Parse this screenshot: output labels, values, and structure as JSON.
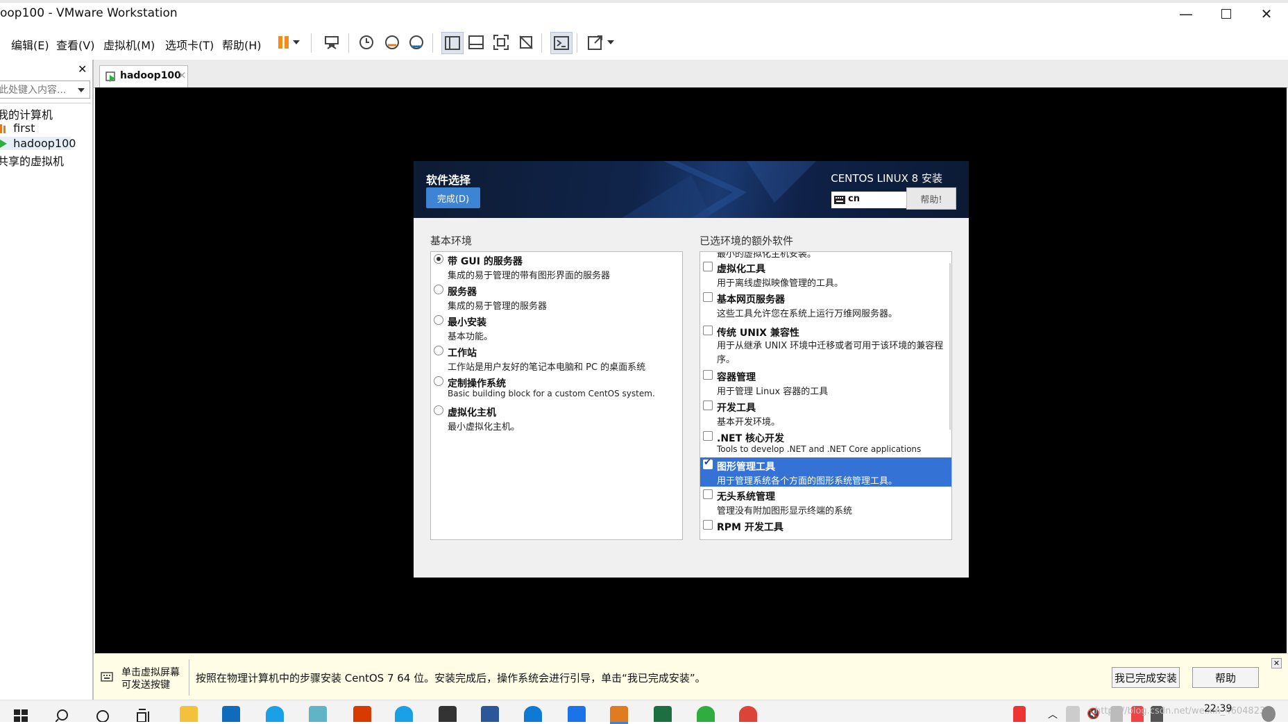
{
  "window": {
    "title": "oop100 - VMware Workstation"
  },
  "menu": {
    "items": [
      "编辑(E)",
      "查看(V)",
      "虚拟机(M)",
      "选项卡(T)",
      "帮助(H)"
    ]
  },
  "toolbar": {
    "icons": [
      "pause-icon",
      "dropdown-arrow-icon",
      "send-ctrl-alt-del-icon",
      "snapshot-icon",
      "revert-snapshot-icon",
      "snapshot-manager-icon",
      "library-view-icon",
      "thumbnail-view-icon",
      "fit-guest-icon",
      "fullscreen-off-icon",
      "console-icon",
      "fullscreen-icon",
      "dropdown-arrow-icon"
    ]
  },
  "sidebar": {
    "close_glyph": "✕",
    "search_placeholder": "此处键入内容...",
    "items": [
      {
        "label": "我的计算机",
        "icon": "computer-icon"
      },
      {
        "label": "first",
        "icon": "vm-icon"
      },
      {
        "label": "hadoop100",
        "icon": "vm-running-icon"
      },
      {
        "label": "共享的虚拟机",
        "icon": "shared-icon"
      }
    ]
  },
  "tab": {
    "label": "hadoop100",
    "close": "×"
  },
  "installer": {
    "section_title": "软件选择",
    "done_button": "完成(D)",
    "product": "CENTOS LINUX 8 安装",
    "keyboard": "cn",
    "help_button": "帮助!",
    "base_env_title": "基本环境",
    "addons_title": "已选环境的额外软件",
    "environments": [
      {
        "title": "带 GUI 的服务器",
        "desc": "集成的易于管理的带有图形界面的服务器",
        "selected": true
      },
      {
        "title": "服务器",
        "desc": "集成的易于管理的服务器",
        "selected": false
      },
      {
        "title": "最小安装",
        "desc": "基本功能。",
        "selected": false
      },
      {
        "title": "工作站",
        "desc": "工作站是用户友好的笔记本电脑和 PC 的桌面系统",
        "selected": false
      },
      {
        "title": "定制操作系统",
        "desc": "Basic building block for a custom CentOS system.",
        "selected": false
      },
      {
        "title": "虚拟化主机",
        "desc": "最小虚拟化主机。",
        "selected": false
      }
    ],
    "addons_partial_top": "最小的虚拟化主机安装。",
    "addons": [
      {
        "title": "虚拟化工具",
        "desc": "用于离线虚拟映像管理的工具。",
        "checked": false
      },
      {
        "title": "基本网页服务器",
        "desc": "这些工具允许您在系统上运行万维网服务器。",
        "checked": false
      },
      {
        "title": "传统 UNIX 兼容性",
        "desc": "用于从继承 UNIX 环境中迁移或者可用于该环境的兼容程序。",
        "checked": false
      },
      {
        "title": "容器管理",
        "desc": "用于管理 Linux 容器的工具",
        "checked": false
      },
      {
        "title": "开发工具",
        "desc": "基本开发环境。",
        "checked": false
      },
      {
        "title": ".NET 核心开发",
        "desc": "Tools to develop .NET and .NET Core applications",
        "checked": false
      },
      {
        "title": "图形管理工具",
        "desc": "用于管理系统各个方面的图形系统管理工具。",
        "checked": true
      },
      {
        "title": "无头系统管理",
        "desc": "管理没有附加图形显示终端的系统",
        "checked": false
      },
      {
        "title": "RPM 开发工具",
        "desc": "",
        "checked": false
      }
    ]
  },
  "notice": {
    "hint_line1": "单击虚拟屏幕",
    "hint_line2": "可发送按键",
    "message": "按照在物理计算机中的步骤安装 CentOS 7 64 位。安装完成后，操作系统会进行引导，单击“我已完成安装”。",
    "done_button": "我已完成安装",
    "help_button": "帮助",
    "close": "✕"
  },
  "taskbar": {
    "clock": "22:39",
    "watermark": "https://blog.csdn.net/weixin_46048230",
    "colors": {
      "excel": "#1d6f42",
      "office": "#d83b01",
      "edge": "#0f7ad5",
      "chrome": "#db4437",
      "360": "#2fae3f",
      "mail": "#0f6cbd"
    }
  },
  "colors": {
    "accent_blue": "#3d85d4",
    "selection_blue": "#3472d6",
    "pause_orange": "#f28c1a"
  }
}
